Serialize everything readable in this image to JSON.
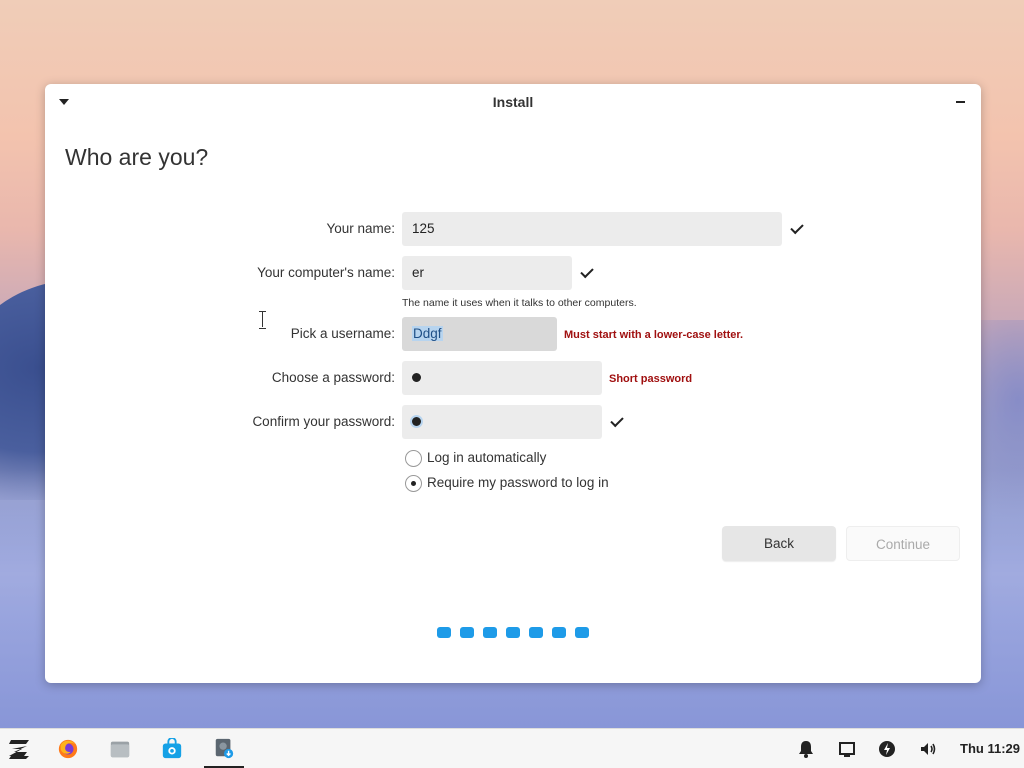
{
  "window": {
    "title": "Install"
  },
  "page": {
    "heading": "Who are you?"
  },
  "form": {
    "your_name_label": "Your name:",
    "your_name_value": "125",
    "computer_name_label": "Your computer's name:",
    "computer_name_value": "er",
    "computer_name_hint": "The name it uses when it talks to other computers.",
    "username_label": "Pick a username:",
    "username_value": "Ddgf",
    "username_error": "Must start with a lower-case letter.",
    "password_label": "Choose a password:",
    "password_error": "Short password",
    "confirm_label": "Confirm your password:",
    "login_auto_label": "Log in automatically",
    "login_require_label": "Require my password to log in",
    "login_option_selected": "Require my password to log in"
  },
  "buttons": {
    "back": "Back",
    "continue": "Continue"
  },
  "progress": {
    "steps": 7,
    "accent": "#1e9be8"
  },
  "taskbar": {
    "apps": [
      "zorin-menu-icon",
      "firefox-icon",
      "files-icon",
      "software-store-icon",
      "installer-icon"
    ],
    "tray": [
      "bell-icon",
      "display-icon",
      "power-icon",
      "volume-icon"
    ],
    "clock": "Thu 11:29"
  },
  "colors": {
    "error": "#a01010",
    "accent": "#1e9be8"
  }
}
